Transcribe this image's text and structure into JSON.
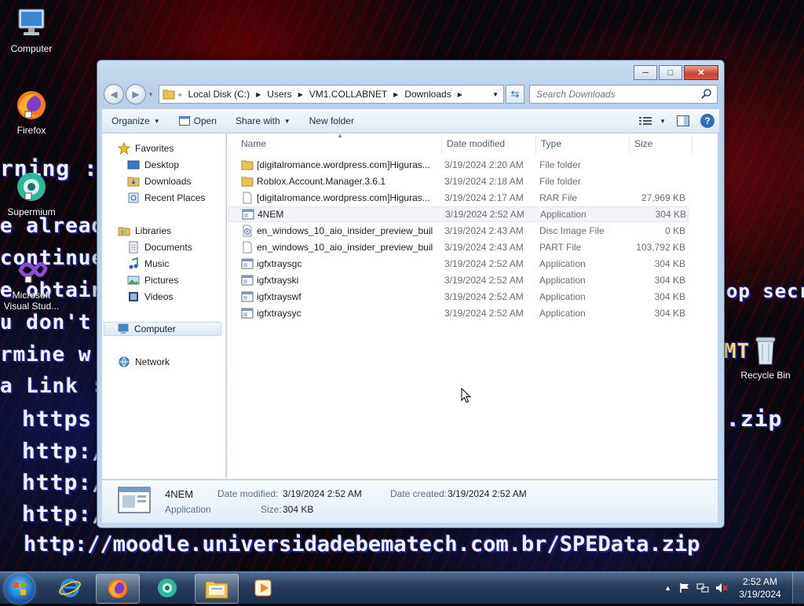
{
  "desktop": {
    "icons": [
      {
        "label": "Computer"
      },
      {
        "label": "Firefox"
      },
      {
        "label": "Supermium"
      },
      {
        "label": "Microsoft Visual Stud..."
      },
      {
        "label": "Recycle Bin"
      }
    ],
    "wallpaper_lines": [
      "rning :",
      "e alread",
      "continue",
      "e obtain",
      "u don't c",
      "rmine w",
      "a Link :",
      "https:",
      "http:/",
      "http:/",
      "http:/",
      "http://moodle.universidadebematech.com.br/SPEData.zip"
    ],
    "wallpaper_right": [
      ".zip",
      "op secr",
      "MT"
    ]
  },
  "window": {
    "address": {
      "segments": [
        "Local Disk (C:)",
        "Users",
        "VM1.COLLABNET",
        "Downloads"
      ]
    },
    "search_placeholder": "Search Downloads",
    "toolbar": {
      "organize": "Organize",
      "open": "Open",
      "share_with": "Share with",
      "new_folder": "New folder"
    },
    "nav": {
      "favorites": "Favorites",
      "desktop": "Desktop",
      "downloads": "Downloads",
      "recent": "Recent Places",
      "libraries": "Libraries",
      "documents": "Documents",
      "music": "Music",
      "pictures": "Pictures",
      "videos": "Videos",
      "computer": "Computer",
      "network": "Network"
    },
    "columns": {
      "name": "Name",
      "date": "Date modified",
      "type": "Type",
      "size": "Size"
    },
    "files": [
      {
        "name": "[digitalromance.wordpress.com]Higuras...",
        "date": "3/19/2024 2:20 AM",
        "type": "File folder",
        "size": "",
        "icon": "folder-icon"
      },
      {
        "name": "Roblox.Account.Manager.3.6.1",
        "date": "3/19/2024 2:18 AM",
        "type": "File folder",
        "size": "",
        "icon": "folder-icon"
      },
      {
        "name": "[digitalromance.wordpress.com]Higuras...",
        "date": "3/19/2024 2:17 AM",
        "type": "RAR File",
        "size": "27,969 KB",
        "icon": "file-icon"
      },
      {
        "name": "4NEM",
        "date": "3/19/2024 2:52 AM",
        "type": "Application",
        "size": "304 KB",
        "icon": "application-icon"
      },
      {
        "name": "en_windows_10_aio_insider_preview_buil...",
        "date": "3/19/2024 2:43 AM",
        "type": "Disc Image File",
        "size": "0 KB",
        "icon": "disc-image-icon"
      },
      {
        "name": "en_windows_10_aio_insider_preview_buil...",
        "date": "3/19/2024 2:43 AM",
        "type": "PART File",
        "size": "103,792 KB",
        "icon": "file-icon"
      },
      {
        "name": "igfxtraysgc",
        "date": "3/19/2024 2:52 AM",
        "type": "Application",
        "size": "304 KB",
        "icon": "application-icon"
      },
      {
        "name": "igfxtrayski",
        "date": "3/19/2024 2:52 AM",
        "type": "Application",
        "size": "304 KB",
        "icon": "application-icon"
      },
      {
        "name": "igfxtrayswf",
        "date": "3/19/2024 2:52 AM",
        "type": "Application",
        "size": "304 KB",
        "icon": "application-icon"
      },
      {
        "name": "igfxtraysyc",
        "date": "3/19/2024 2:52 AM",
        "type": "Application",
        "size": "304 KB",
        "icon": "application-icon"
      }
    ],
    "details": {
      "name": "4NEM",
      "type": "Application",
      "date_modified_label": "Date modified:",
      "date_modified": "3/19/2024 2:52 AM",
      "date_created_label": "Date created:",
      "date_created": "3/19/2024 2:52 AM",
      "size_label": "Size:",
      "size": "304 KB"
    }
  },
  "taskbar": {
    "clock_time": "2:52 AM",
    "clock_date": "3/19/2024"
  }
}
